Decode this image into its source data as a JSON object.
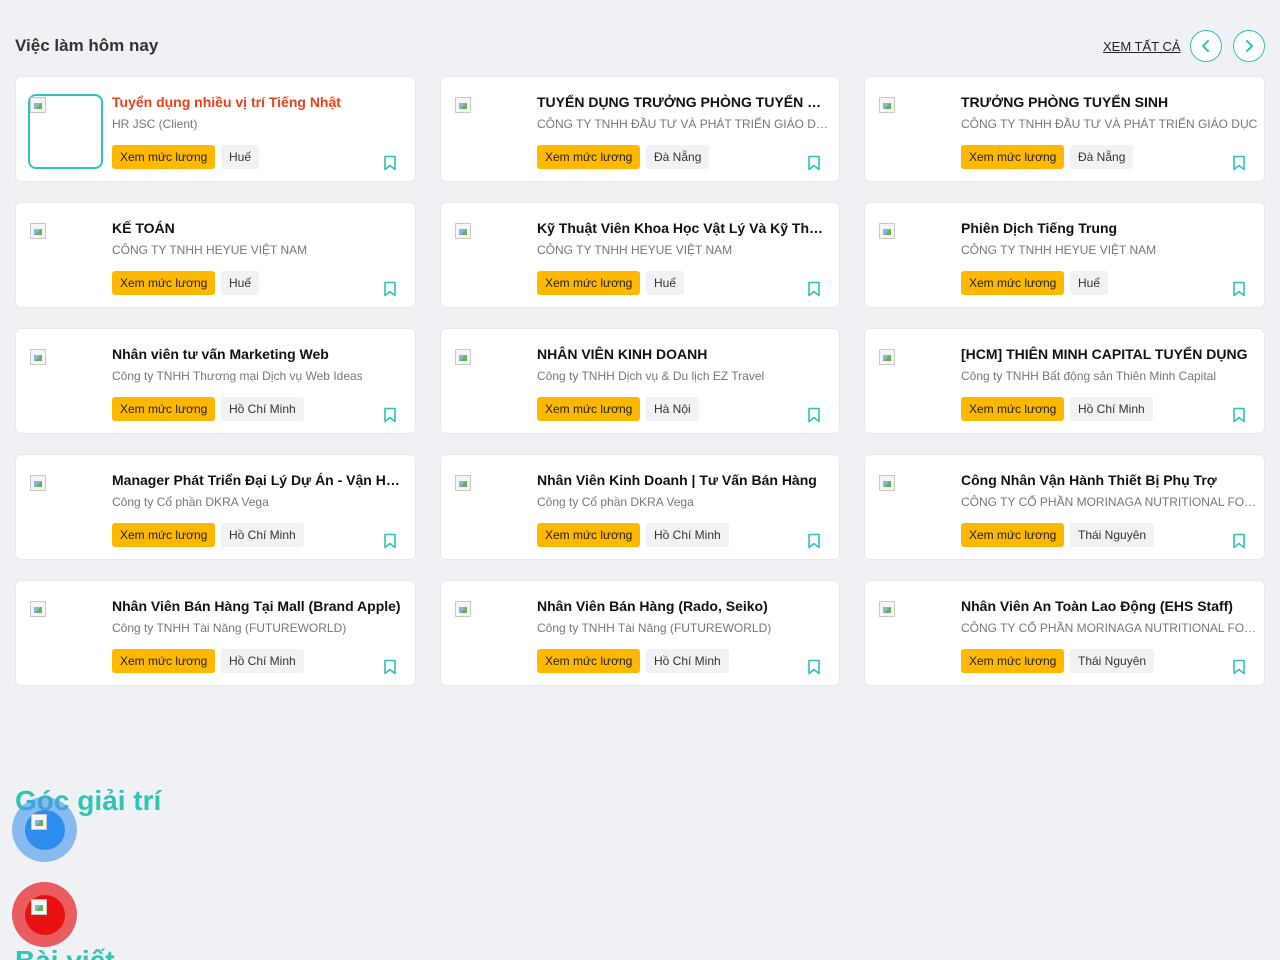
{
  "header": {
    "title": "Việc làm hôm nay",
    "see_all": "XEM TẤT CẢ",
    "prev_icon": "chevron-left-icon",
    "next_icon": "chevron-right-icon"
  },
  "colors": {
    "accent": "#2ec4b6",
    "salary": "#ffb800",
    "highlight_title": "#e8411b"
  },
  "jobs": [
    {
      "title": "Tuyển dụng nhiều vị trí Tiếng Nhật",
      "company": "HR JSC (Client)",
      "salary": "Xem mức lương",
      "location": "Huế",
      "featured": true
    },
    {
      "title": "TUYỂN DỤNG TRƯỞNG PHÒNG TUYỂN SINH",
      "company": "CÔNG TY TNHH ĐẦU TƯ VÀ PHÁT TRIỂN GIÁO DỤC",
      "salary": "Xem mức lương",
      "location": "Đà Nẵng"
    },
    {
      "title": "TRƯỞNG PHÒNG TUYỂN SINH",
      "company": "CÔNG TY TNHH ĐẦU TƯ VÀ PHÁT TRIỂN GIÁO DỤC",
      "salary": "Xem mức lương",
      "location": "Đà Nẵng"
    },
    {
      "title": "KẾ TOÁN",
      "company": "CÔNG TY TNHH HEYUE VIỆT NAM",
      "salary": "Xem mức lương",
      "location": "Huế"
    },
    {
      "title": "Kỹ Thuật Viên Khoa Học Vật Lý Và Kỹ Thuật",
      "company": "CÔNG TY TNHH HEYUE VIỆT NAM",
      "salary": "Xem mức lương",
      "location": "Huế"
    },
    {
      "title": "Phiên Dịch Tiếng Trung",
      "company": "CÔNG TY TNHH HEYUE VIỆT NAM",
      "salary": "Xem mức lương",
      "location": "Huế"
    },
    {
      "title": "Nhân viên tư vấn Marketing Web",
      "company": "Công ty TNHH Thương mại Dịch vụ Web Ideas",
      "salary": "Xem mức lương",
      "location": "Hồ Chí Minh"
    },
    {
      "title": "NHÂN VIÊN KINH DOANH",
      "company": "Công ty TNHH Dịch vụ & Du lịch EZ Travel",
      "salary": "Xem mức lương",
      "location": "Hà Nội"
    },
    {
      "title": "[HCM] THIÊN MINH CAPITAL TUYỂN DỤNG",
      "company": "Công ty TNHH Bất động sản Thiên Minh Capital",
      "salary": "Xem mức lương",
      "location": "Hồ Chí Minh"
    },
    {
      "title": "Manager Phát Triển Đại Lý Dự Án - Vận Hành",
      "company": "Công ty Cổ phần DKRA Vega",
      "salary": "Xem mức lương",
      "location": "Hồ Chí Minh"
    },
    {
      "title": "Nhân Viên Kinh Doanh | Tư Vấn Bán Hàng",
      "company": "Công ty Cổ phần DKRA Vega",
      "salary": "Xem mức lương",
      "location": "Hồ Chí Minh"
    },
    {
      "title": "Công Nhân Vận Hành Thiết Bị Phụ Trợ",
      "company": "CÔNG TY CỔ PHẦN MORINAGA NUTRITIONAL FOODS",
      "salary": "Xem mức lương",
      "location": "Thái Nguyên"
    },
    {
      "title": "Nhân Viên Bán Hàng Tại Mall (Brand Apple)",
      "company": "Công ty TNHH Tài Năng (FUTUREWORLD)",
      "salary": "Xem mức lương",
      "location": "Hồ Chí Minh"
    },
    {
      "title": "Nhân Viên Bán Hàng (Rado, Seiko)",
      "company": "Công ty TNHH Tài Năng (FUTUREWORLD)",
      "salary": "Xem mức lương",
      "location": "Hồ Chí Minh"
    },
    {
      "title": "Nhân Viên An Toàn Lao Động (EHS Staff)",
      "company": "CÔNG TY CỔ PHẦN MORINAGA NUTRITIONAL FOODS",
      "salary": "Xem mức lương",
      "location": "Thái Nguyên"
    }
  ],
  "sections": {
    "entertainment_title": "Góc giải trí",
    "next_title": "Bài viết"
  },
  "floating": {
    "chat_icon": "chat-icon",
    "call_icon": "phone-icon"
  }
}
